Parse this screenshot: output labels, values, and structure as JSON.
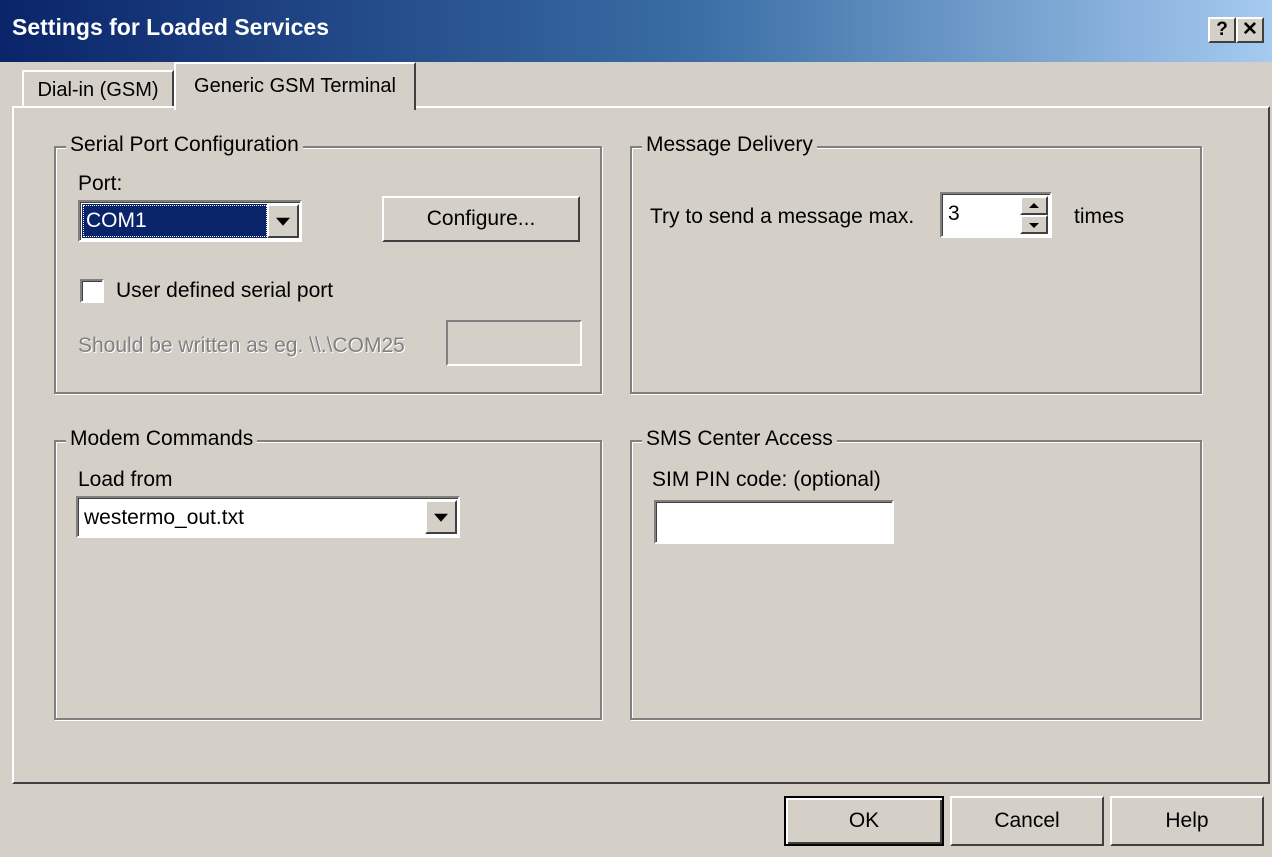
{
  "window": {
    "title": "Settings for Loaded Services",
    "help_button": "?",
    "close_button": "✕"
  },
  "tabs": [
    {
      "label": "Dial-in (GSM)",
      "active": false
    },
    {
      "label": "Generic GSM Terminal",
      "active": true
    }
  ],
  "serial_port": {
    "legend": "Serial Port Configuration",
    "port_label": "Port:",
    "port_value": "COM1",
    "configure_label": "Configure...",
    "user_defined_label": "User defined serial port",
    "user_defined_checked": false,
    "hint_text": "Should be written as eg. \\\\.\\COM25",
    "custom_port_value": ""
  },
  "message_delivery": {
    "legend": "Message Delivery",
    "try_label": "Try to send a message max.",
    "max_tries": "3",
    "times_label": "times"
  },
  "modem_commands": {
    "legend": "Modem Commands",
    "load_label": "Load from",
    "load_value": "westermo_out.txt"
  },
  "sms_center": {
    "legend": "SMS Center Access",
    "pin_label": "SIM PIN code: (optional)",
    "pin_value": ""
  },
  "footer": {
    "ok_label": "OK",
    "cancel_label": "Cancel",
    "help_label": "Help"
  },
  "colors": {
    "title_start": "#0a246a",
    "title_end": "#a6caf0",
    "face": "#d4d0c8",
    "selection": "#0a246a"
  }
}
